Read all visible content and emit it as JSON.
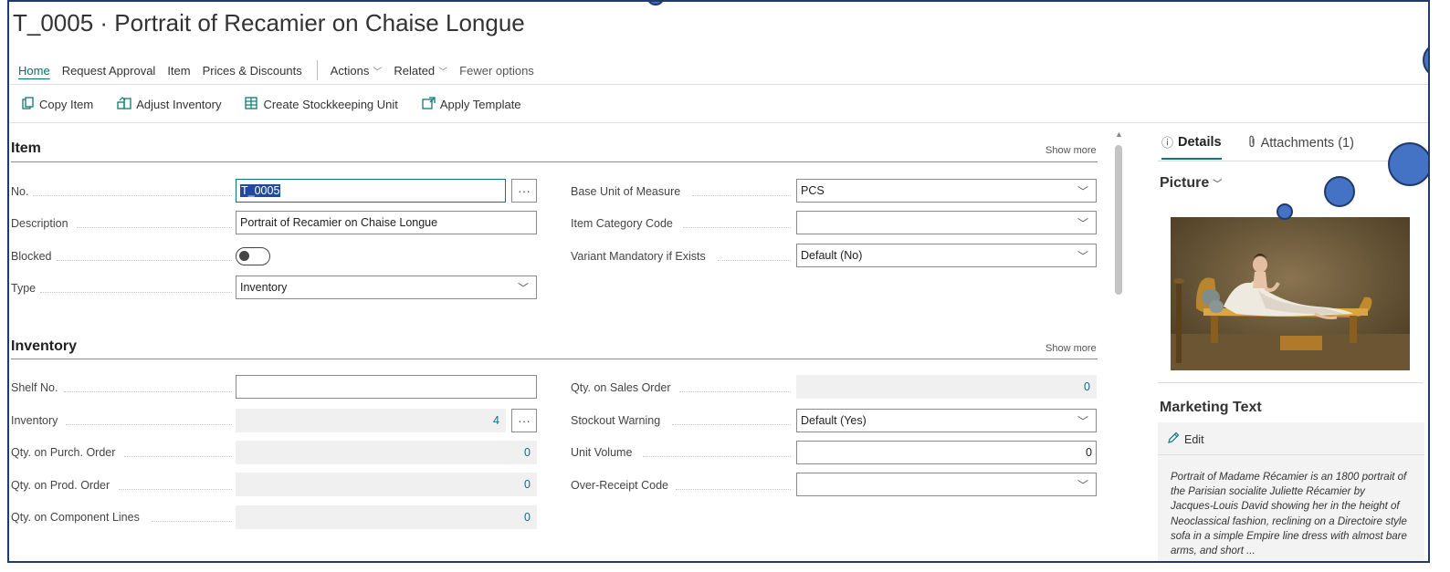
{
  "page_title": "T_0005 · Portrait of Recamier on Chaise Longue",
  "nav": {
    "home": "Home",
    "request_approval": "Request Approval",
    "item": "Item",
    "prices_discounts": "Prices & Discounts",
    "actions": "Actions",
    "related": "Related",
    "fewer_options": "Fewer options"
  },
  "toolbar": {
    "copy_item": "Copy Item",
    "adjust_inventory": "Adjust Inventory",
    "create_sku": "Create Stockkeeping Unit",
    "apply_template": "Apply Template"
  },
  "item_section": {
    "title": "Item",
    "show_more": "Show more",
    "no_label": "No.",
    "no_value": "T_0005",
    "description_label": "Description",
    "description_value": "Portrait of Recamier on Chaise Longue",
    "blocked_label": "Blocked",
    "blocked_value": false,
    "type_label": "Type",
    "type_value": "Inventory",
    "base_uom_label": "Base Unit of Measure",
    "base_uom_value": "PCS",
    "item_category_label": "Item Category Code",
    "item_category_value": "",
    "variant_mandatory_label": "Variant Mandatory if Exists",
    "variant_mandatory_value": "Default (No)"
  },
  "inventory_section": {
    "title": "Inventory",
    "show_more": "Show more",
    "shelf_no_label": "Shelf No.",
    "shelf_no_value": "",
    "inventory_label": "Inventory",
    "inventory_value": "4",
    "qty_purch_label": "Qty. on Purch. Order",
    "qty_purch_value": "0",
    "qty_prod_label": "Qty. on Prod. Order",
    "qty_prod_value": "0",
    "qty_comp_label": "Qty. on Component Lines",
    "qty_comp_value": "0",
    "qty_sales_label": "Qty. on Sales Order",
    "qty_sales_value": "0",
    "stockout_label": "Stockout Warning",
    "stockout_value": "Default (Yes)",
    "unit_volume_label": "Unit Volume",
    "unit_volume_value": "0",
    "over_receipt_label": "Over-Receipt Code",
    "over_receipt_value": ""
  },
  "factbox": {
    "details_tab": "Details",
    "attachments_tab": "Attachments (1)",
    "picture_title": "Picture",
    "marketing_title": "Marketing Text",
    "edit_label": "Edit",
    "marketing_text": "Portrait of Madame Récamier is an 1800 portrait of the Parisian socialite Juliette Récamier by Jacques-Louis David showing her in the height of Neoclassical fashion, reclining on a Directoire style sofa in a simple Empire line dress with almost bare arms, and short ..."
  },
  "icons": {
    "copy": "copy-icon",
    "adjust": "adjust-inventory-icon",
    "create_sku": "create-sku-icon",
    "apply_template": "apply-template-icon",
    "info": "info-icon",
    "attachment": "paperclip-icon",
    "edit": "pencil-icon",
    "dropdown": "chevron-down-icon",
    "lookup": "ellipsis-icon"
  },
  "colors": {
    "accent": "#0b7a75",
    "frame": "#1f3a6b",
    "overlay_circles": "#4472c4",
    "selection": "#1f4aa0"
  }
}
